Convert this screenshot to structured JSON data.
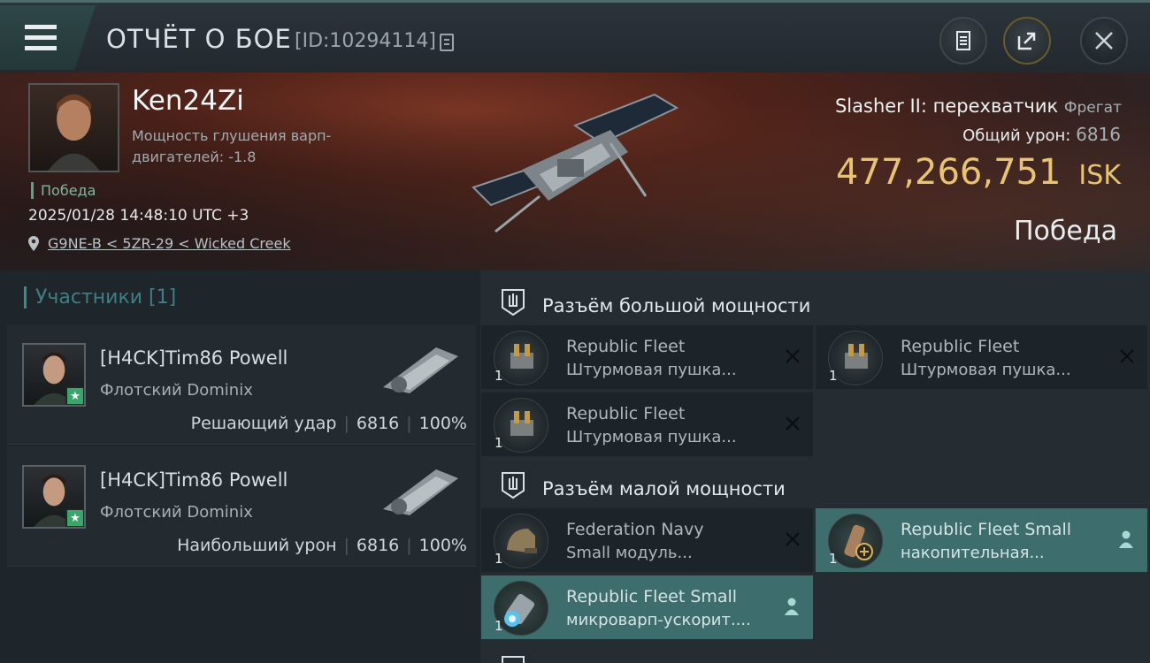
{
  "header": {
    "title": "ОТЧЁТ О БОЕ",
    "id": "[ID:10294114]"
  },
  "victim": {
    "name": "Ken24Zi",
    "stat": "Мощность глушения варп-двигателей: -1.8",
    "badge": "Победа",
    "timestamp": "2025/01/28 14:48:10 UTC +3",
    "location": "G9NE-B < 5ZR-29 < Wicked Creek",
    "ship": "Slasher II: перехватчик",
    "ship_class": "Фрегат",
    "total_damage_label": "Общий урон:",
    "total_damage": "6816",
    "isk_value": "477,266,751",
    "isk_unit": "ISK",
    "result": "Победа"
  },
  "participants": {
    "title": "Участники [1]",
    "items": [
      {
        "name": "[H4CK]Tim86 Powell",
        "ship": "Флотский Dominix",
        "role": "Решающий удар",
        "damage": "6816",
        "percent": "100%"
      },
      {
        "name": "[H4CK]Tim86 Powell",
        "ship": "Флотский Dominix",
        "role": "Наибольший урон",
        "damage": "6816",
        "percent": "100%"
      }
    ]
  },
  "modules": {
    "high_slot_title": "Разъём большой мощности",
    "low_slot_title": "Разъём малой мощности",
    "high": [
      {
        "qty": "1",
        "line1": "Republic Fleet",
        "line2": "Штурмовая пушка...",
        "state": "destroyed"
      },
      {
        "qty": "1",
        "line1": "Republic Fleet",
        "line2": "Штурмовая пушка...",
        "state": "destroyed"
      },
      {
        "qty": "1",
        "line1": "Republic Fleet",
        "line2": "Штурмовая пушка...",
        "state": "destroyed"
      }
    ],
    "low": [
      {
        "qty": "1",
        "line1": "Federation Navy",
        "line2": "Small модуль...",
        "state": "destroyed"
      },
      {
        "qty": "1",
        "line1": "Republic Fleet Small",
        "line2": "накопительная...",
        "state": "dropped"
      },
      {
        "qty": "1",
        "line1": "Republic Fleet Small",
        "line2": "микроварп-ускорит....",
        "state": "dropped"
      }
    ]
  },
  "colors": {
    "accent_teal": "#3d6e6d",
    "isk_gold": "#e8c471",
    "victory_green": "#5aa58a"
  }
}
